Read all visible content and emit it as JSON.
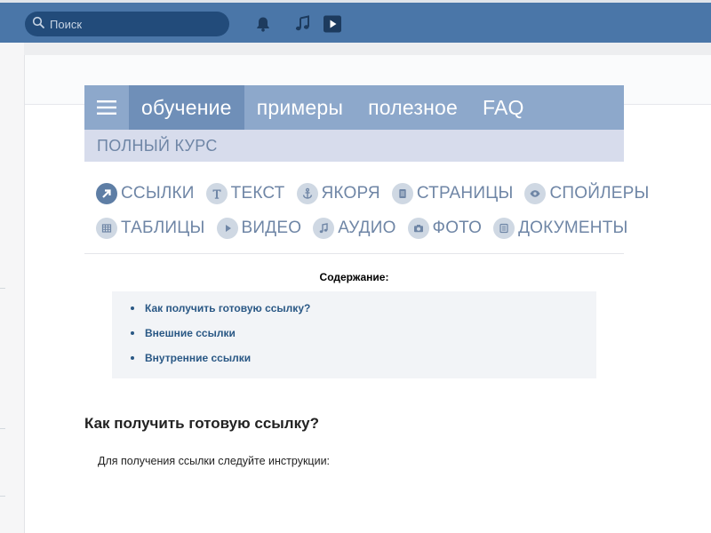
{
  "topbar": {
    "search_placeholder": "Поиск",
    "icons": [
      "search-icon",
      "bell-icon",
      "music-icon",
      "video-play-icon"
    ]
  },
  "nav": {
    "tabs": [
      {
        "label": "обучение",
        "active": true
      },
      {
        "label": "примеры",
        "active": false
      },
      {
        "label": "полезное",
        "active": false
      },
      {
        "label": "FAQ",
        "active": false
      }
    ],
    "subnav_label": "ПОЛНЫЙ КУРС"
  },
  "topics": [
    {
      "label": "ССЫЛКИ",
      "icon": "link-arrow-icon",
      "active": true
    },
    {
      "label": "ТЕКСТ",
      "icon": "text-icon",
      "active": false
    },
    {
      "label": "ЯКОРЯ",
      "icon": "anchor-icon",
      "active": false
    },
    {
      "label": "СТРАНИЦЫ",
      "icon": "page-icon",
      "active": false
    },
    {
      "label": "СПОЙЛЕРЫ",
      "icon": "eye-icon",
      "active": false
    },
    {
      "label": "ТАБЛИЦЫ",
      "icon": "table-icon",
      "active": false
    },
    {
      "label": "ВИДЕО",
      "icon": "play-icon",
      "active": false
    },
    {
      "label": "АУДИО",
      "icon": "note-icon",
      "active": false
    },
    {
      "label": "ФОТО",
      "icon": "camera-icon",
      "active": false
    },
    {
      "label": "ДОКУМЕНТЫ",
      "icon": "document-icon",
      "active": false
    }
  ],
  "toc": {
    "title": "Содержание:",
    "items": [
      "Как получить готовую ссылку?",
      "Внешние ссылки",
      "Внутренние ссылки"
    ]
  },
  "content": {
    "heading": "Как получить готовую ссылку?",
    "paragraph": "Для получения ссылки следуйте инструкции:"
  },
  "colors": {
    "topbar": "#4a76a8",
    "nav": "#8da8cb",
    "nav_active": "#6f8fb8",
    "subnav": "#d7dcec",
    "link": "#2a5885"
  }
}
